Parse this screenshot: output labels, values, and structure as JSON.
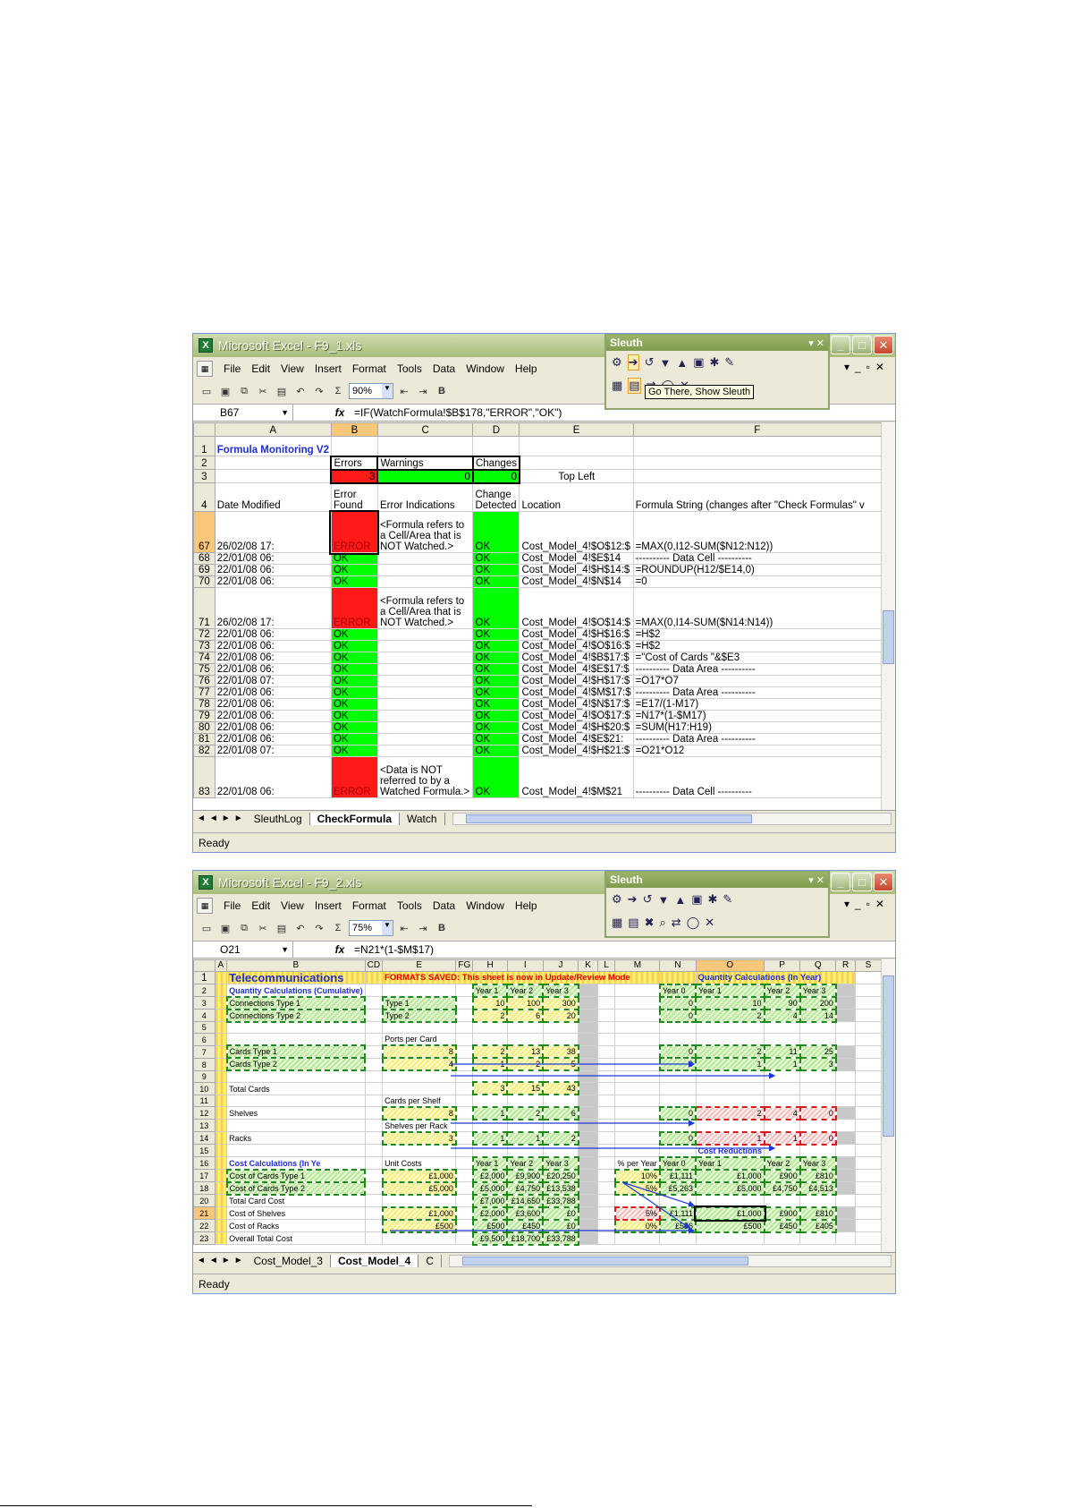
{
  "windows": [
    {
      "title": "Microsoft Excel - F9_1.xls",
      "menu": [
        "File",
        "Edit",
        "View",
        "Insert",
        "Format",
        "Tools",
        "Data",
        "Window",
        "Help"
      ],
      "zoom": "90%",
      "namebox": "B67",
      "formula": "=IF(WatchFormula!$B$178,\"ERROR\",\"OK\")",
      "tooltip": "Go There, Show Sleuth",
      "sleuth_title": "Sleuth",
      "columns": [
        "A",
        "B",
        "C",
        "D",
        "E",
        "F"
      ],
      "header_rows": [
        {
          "row": "1",
          "cells": [
            "Formula Monitoring V2",
            "",
            "",
            "",
            "",
            ""
          ]
        },
        {
          "row": "2",
          "cells": [
            "",
            "Errors",
            "Warnings",
            "Changes",
            "",
            ""
          ]
        },
        {
          "row": "3",
          "cells": [
            "",
            "3",
            "0",
            "0",
            "Top Left",
            ""
          ]
        },
        {
          "row": "4",
          "cells": [
            "Date Modified",
            "Error Found",
            "Error Indications",
            "Change Detected",
            "Location",
            "Formula String (changes after \"Check Formulas\" v"
          ]
        }
      ],
      "rows": [
        {
          "row": "67",
          "date": "26/02/08 17:",
          "found": "ERROR",
          "ind": "<Formula refers to a Cell/Area that is NOT Watched.>",
          "chg": "OK",
          "loc": "Cost_Model_4!$O$12:$",
          "formula": "=MAX(0,I12-SUM($N12:N12))"
        },
        {
          "row": "68",
          "date": "22/01/08 06:",
          "found": "OK",
          "ind": "",
          "chg": "OK",
          "loc": "Cost_Model_4!$E$14",
          "formula": "---------- Data Cell ----------"
        },
        {
          "row": "69",
          "date": "22/01/08 06:",
          "found": "OK",
          "ind": "",
          "chg": "OK",
          "loc": "Cost_Model_4!$H$14:$",
          "formula": "=ROUNDUP(H12/$E14,0)"
        },
        {
          "row": "70",
          "date": "22/01/08 06:",
          "found": "OK",
          "ind": "",
          "chg": "OK",
          "loc": "Cost_Model_4!$N$14",
          "formula": "=0"
        },
        {
          "row": "71",
          "date": "26/02/08 17:",
          "found": "ERROR",
          "ind": "<Formula refers to a Cell/Area that is NOT Watched.>",
          "chg": "OK",
          "loc": "Cost_Model_4!$O$14:$",
          "formula": "=MAX(0,I14-SUM($N14:N14))"
        },
        {
          "row": "72",
          "date": "22/01/08 06:",
          "found": "OK",
          "ind": "",
          "chg": "OK",
          "loc": "Cost_Model_4!$H$16:$",
          "formula": "=H$2"
        },
        {
          "row": "73",
          "date": "22/01/08 06:",
          "found": "OK",
          "ind": "",
          "chg": "OK",
          "loc": "Cost_Model_4!$O$16:$",
          "formula": "=H$2"
        },
        {
          "row": "74",
          "date": "22/01/08 06:",
          "found": "OK",
          "ind": "",
          "chg": "OK",
          "loc": "Cost_Model_4!$B$17:$",
          "formula": "=\"Cost of Cards \"&$E3"
        },
        {
          "row": "75",
          "date": "22/01/08 06:",
          "found": "OK",
          "ind": "",
          "chg": "OK",
          "loc": "Cost_Model_4!$E$17:$",
          "formula": "---------- Data Area ----------"
        },
        {
          "row": "76",
          "date": "22/01/08 07:",
          "found": "OK",
          "ind": "",
          "chg": "OK",
          "loc": "Cost_Model_4!$H$17:$",
          "formula": "=O17*O7"
        },
        {
          "row": "77",
          "date": "22/01/08 06:",
          "found": "OK",
          "ind": "",
          "chg": "OK",
          "loc": "Cost_Model_4!$M$17:$",
          "formula": "---------- Data Area ----------"
        },
        {
          "row": "78",
          "date": "22/01/08 06:",
          "found": "OK",
          "ind": "",
          "chg": "OK",
          "loc": "Cost_Model_4!$N$17:$",
          "formula": "=E17/(1-M17)"
        },
        {
          "row": "79",
          "date": "22/01/08 06:",
          "found": "OK",
          "ind": "",
          "chg": "OK",
          "loc": "Cost_Model_4!$O$17:$",
          "formula": "=N17*(1-$M17)"
        },
        {
          "row": "80",
          "date": "22/01/08 06:",
          "found": "OK",
          "ind": "",
          "chg": "OK",
          "loc": "Cost_Model_4!$H$20:$",
          "formula": "=SUM(H17:H19)"
        },
        {
          "row": "81",
          "date": "22/01/08 06:",
          "found": "OK",
          "ind": "",
          "chg": "OK",
          "loc": "Cost_Model_4!$E$21:",
          "formula": "---------- Data Area ----------"
        },
        {
          "row": "82",
          "date": "22/01/08 07:",
          "found": "OK",
          "ind": "",
          "chg": "OK",
          "loc": "Cost_Model_4!$H$21:$",
          "formula": "=O21*O12"
        },
        {
          "row": "83",
          "date": "22/01/08 06:",
          "found": "ERROR",
          "ind": "<Data is NOT referred to by a Watched Formula.>",
          "chg": "OK",
          "loc": "Cost_Model_4!$M$21",
          "formula": "---------- Data Cell ----------"
        }
      ],
      "tabs": [
        "SleuthLog",
        "CheckFormula",
        "Watch"
      ],
      "active_tab": "CheckFormula",
      "status": "Ready"
    },
    {
      "title": "Microsoft Excel - F9_2.xls",
      "menu": [
        "File",
        "Edit",
        "View",
        "Insert",
        "Format",
        "Tools",
        "Data",
        "Window",
        "Help"
      ],
      "zoom": "75%",
      "namebox": "O21",
      "formula": "=N21*(1-$M$17)",
      "sleuth_title": "Sleuth",
      "columns": [
        "A",
        "B",
        "CD",
        "E",
        "FG",
        "H",
        "I",
        "J",
        "K",
        "L",
        "M",
        "N",
        "O",
        "P",
        "Q",
        "R",
        "S"
      ],
      "banner": {
        "title": "Telecommunications",
        "formats": "FORMATS SAVED:  This sheet is now in Update/Review Mode",
        "qty_in_year": "Quantity Calculations (In Year)"
      },
      "sheet_rows": [
        {
          "row": "2",
          "b": "Quantity Calculations (Cumulative)",
          "e": "",
          "h": "Year 1",
          "i": "Year 2",
          "j": "Year 3",
          "m": "",
          "n": "Year 0",
          "o": "Year 1",
          "p": "Year 2",
          "q": "Year 3"
        },
        {
          "row": "3",
          "b": "Connections Type 1",
          "e": "Type 1",
          "h": "10",
          "i": "100",
          "j": "300",
          "m": "",
          "n": "0",
          "o": "10",
          "p": "90",
          "q": "200"
        },
        {
          "row": "4",
          "b": "Connections Type 2",
          "e": "Type 2",
          "h": "2",
          "i": "6",
          "j": "20",
          "m": "",
          "n": "0",
          "o": "2",
          "p": "4",
          "q": "14"
        },
        {
          "row": "5",
          "b": "",
          "e": "",
          "h": "",
          "i": "",
          "j": "",
          "m": "",
          "n": "",
          "o": "",
          "p": "",
          "q": ""
        },
        {
          "row": "6",
          "b": "",
          "e": "Ports per Card",
          "h": "",
          "i": "",
          "j": "",
          "m": "",
          "n": "",
          "o": "",
          "p": "",
          "q": ""
        },
        {
          "row": "7",
          "b": "Cards Type 1",
          "e": "8",
          "h": "2",
          "i": "13",
          "j": "38",
          "m": "",
          "n": "0",
          "o": "2",
          "p": "11",
          "q": "25"
        },
        {
          "row": "8",
          "b": "Cards Type 2",
          "e": "4",
          "h": "1",
          "i": "2",
          "j": "5",
          "m": "",
          "n": "0",
          "o": "1",
          "p": "1",
          "q": "3"
        },
        {
          "row": "9",
          "b": "",
          "e": "",
          "h": "",
          "i": "",
          "j": "",
          "m": "",
          "n": "",
          "o": "",
          "p": "",
          "q": ""
        },
        {
          "row": "10",
          "b": "Total Cards",
          "e": "",
          "h": "3",
          "i": "15",
          "j": "43",
          "m": "",
          "n": "",
          "o": "",
          "p": "",
          "q": ""
        },
        {
          "row": "11",
          "b": "",
          "e": "Cards per Shelf",
          "h": "",
          "i": "",
          "j": "",
          "m": "",
          "n": "",
          "o": "",
          "p": "",
          "q": ""
        },
        {
          "row": "12",
          "b": "Shelves",
          "e": "8",
          "h": "1",
          "i": "2",
          "j": "6",
          "m": "",
          "n": "0",
          "o": "2",
          "p": "4",
          "q": "0"
        },
        {
          "row": "13",
          "b": "",
          "e": "Shelves per Rack",
          "h": "",
          "i": "",
          "j": "",
          "m": "",
          "n": "",
          "o": "",
          "p": "",
          "q": ""
        },
        {
          "row": "14",
          "b": "Racks",
          "e": "3",
          "h": "1",
          "i": "1",
          "j": "2",
          "m": "",
          "n": "0",
          "o": "1",
          "p": "1",
          "q": "0"
        },
        {
          "row": "15",
          "b": "",
          "e": "",
          "h": "",
          "i": "",
          "j": "",
          "m": "",
          "n": "",
          "o": "Cost Reductions",
          "p": "",
          "q": ""
        },
        {
          "row": "16",
          "b": "Cost Calculations (In Ye",
          "e": "Unit Costs",
          "h": "Year 1",
          "i": "Year 2",
          "j": "Year 3",
          "m": "% per Year",
          "n": "Year 0",
          "o": "Year 1",
          "p": "Year 2",
          "q": "Year 3"
        },
        {
          "row": "17",
          "b": "Cost of Cards Type 1",
          "e": "£1,000",
          "h": "£2,000",
          "i": "£9,900",
          "j": "£20,250",
          "m": "10%",
          "n": "£1,111",
          "o": "£1,000",
          "p": "£900",
          "q": "£810"
        },
        {
          "row": "18",
          "b": "Cost of Cards Type 2",
          "e": "£5,000",
          "h": "£5,000",
          "i": "£4,750",
          "j": "£13,538",
          "m": "5%",
          "n": "£5,263",
          "o": "£5,000",
          "p": "£4,750",
          "q": "£4,513"
        },
        {
          "row": "20",
          "b": "Total Card Cost",
          "e": "",
          "h": "£7,000",
          "i": "£14,650",
          "j": "£33,788",
          "m": "",
          "n": "",
          "o": "",
          "p": "",
          "q": ""
        },
        {
          "row": "21",
          "b": "Cost of Shelves",
          "e": "£1,000",
          "h": "£2,000",
          "i": "£3,600",
          "j": "£0",
          "m": "5%",
          "n": "£1,111",
          "o": "£1,000",
          "p": "£900",
          "q": "£810"
        },
        {
          "row": "22",
          "b": "Cost of Racks",
          "e": "£500",
          "h": "£500",
          "i": "£450",
          "j": "£0",
          "m": "0%",
          "n": "£556",
          "o": "£500",
          "p": "£450",
          "q": "£405"
        },
        {
          "row": "23",
          "b": "Overall Total Cost",
          "e": "",
          "h": "£9,500",
          "i": "£18,700",
          "j": "£33,788",
          "m": "",
          "n": "",
          "o": "",
          "p": "",
          "q": ""
        }
      ],
      "tabs": [
        "Cost_Model_3",
        "Cost_Model_4",
        "C"
      ],
      "active_tab": "Cost_Model_4",
      "status": "Ready"
    }
  ]
}
